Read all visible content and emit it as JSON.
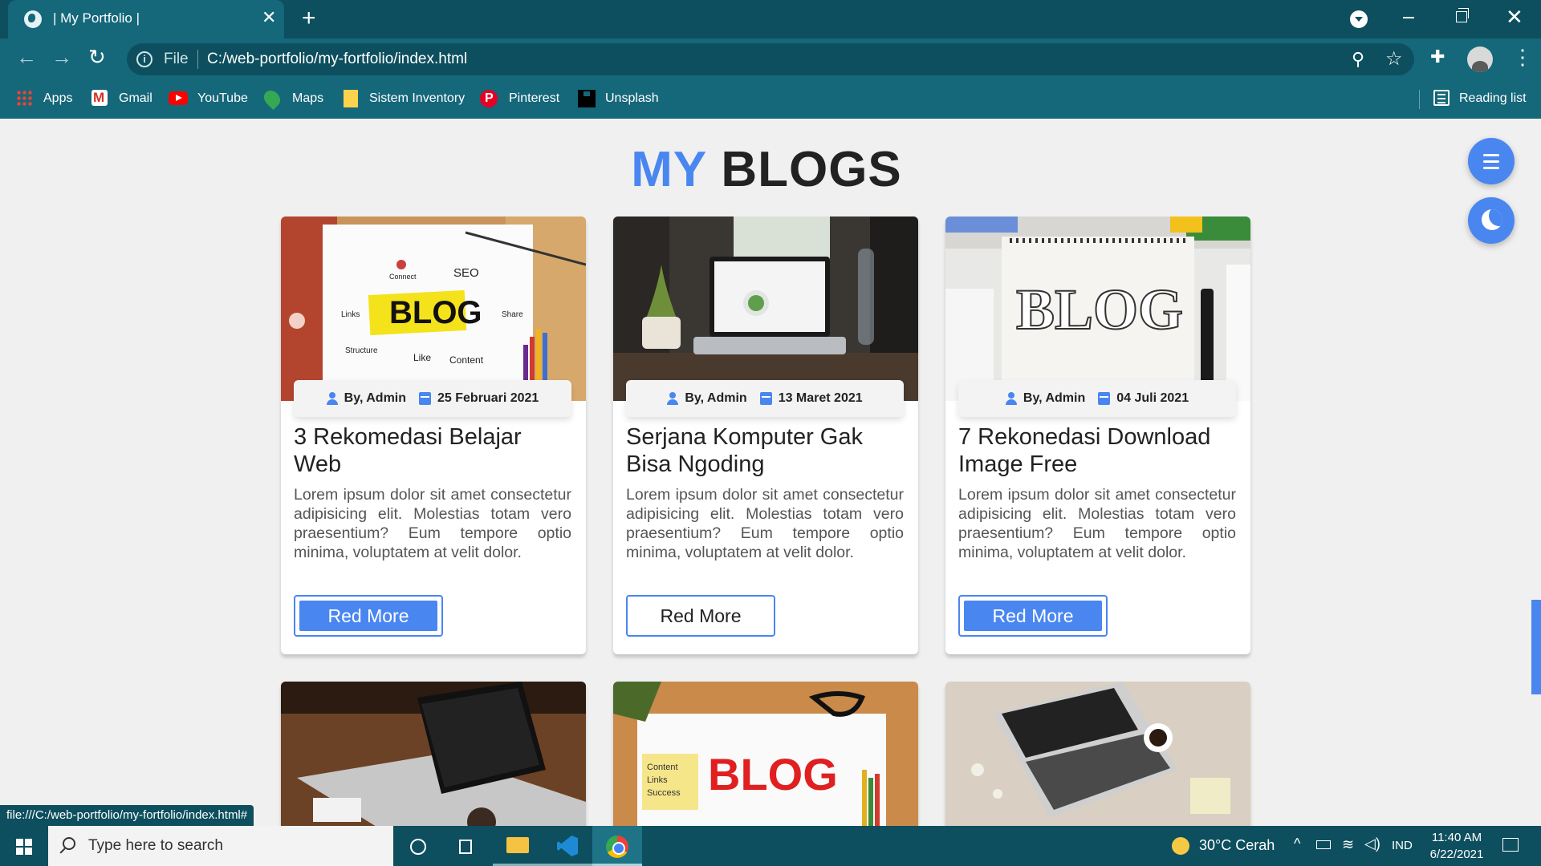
{
  "browser": {
    "tab_title": "| My Portfolio |",
    "tab_close": "✕",
    "new_tab": "+",
    "file_label": "File",
    "url": "C:/web-portfolio/my-fortfolio/index.html",
    "bookmarks": [
      {
        "label": "Apps",
        "icon": "apps-grid-icon"
      },
      {
        "label": "Gmail",
        "icon": "gmail-icon"
      },
      {
        "label": "YouTube",
        "icon": "youtube-icon"
      },
      {
        "label": "Maps",
        "icon": "maps-icon"
      },
      {
        "label": "Sistem Inventory",
        "icon": "folder-icon"
      },
      {
        "label": "Pinterest",
        "icon": "pinterest-icon"
      },
      {
        "label": "Unsplash",
        "icon": "unsplash-icon"
      }
    ],
    "reading_list": "Reading list",
    "status_url": "file:///C:/web-portfolio/my-fortfolio/index.html#"
  },
  "page": {
    "heading_accent": "MY",
    "heading_rest": "BLOGS",
    "accent_color": "#4a86f0"
  },
  "cards": [
    {
      "author": "By, Admin",
      "date": "25 Februari 2021",
      "title": "3 Rekomedasi Belajar Web",
      "body": "Lorem ipsum dolor sit amet consectetur adipisicing elit. Molestias totam vero praesentium? Eum tempore optio minima, voluptatem at velit dolor.",
      "button": "Red More",
      "button_style": "filled",
      "image": "blog-concept-diagram"
    },
    {
      "author": "By, Admin",
      "date": "13 Maret 2021",
      "title": "Serjana Komputer Gak Bisa Ngoding",
      "body": "Lorem ipsum dolor sit amet consectetur adipisicing elit. Molestias totam vero praesentium? Eum tempore optio minima, voluptatem at velit dolor.",
      "button": "Red More",
      "button_style": "outline",
      "image": "laptop-on-desk"
    },
    {
      "author": "By, Admin",
      "date": "04 Juli 2021",
      "title": "7 Rekonedasi Download Image Free",
      "body": "Lorem ipsum dolor sit amet consectetur adipisicing elit. Molestias totam vero praesentium? Eum tempore optio minima, voluptatem at velit dolor.",
      "button": "Red More",
      "button_style": "filled",
      "image": "blog-notepad"
    }
  ],
  "taskbar": {
    "search_placeholder": "Type here to search",
    "weather": "30°C  Cerah",
    "language": "IND",
    "time": "11:40 AM",
    "date": "6/22/2021"
  }
}
